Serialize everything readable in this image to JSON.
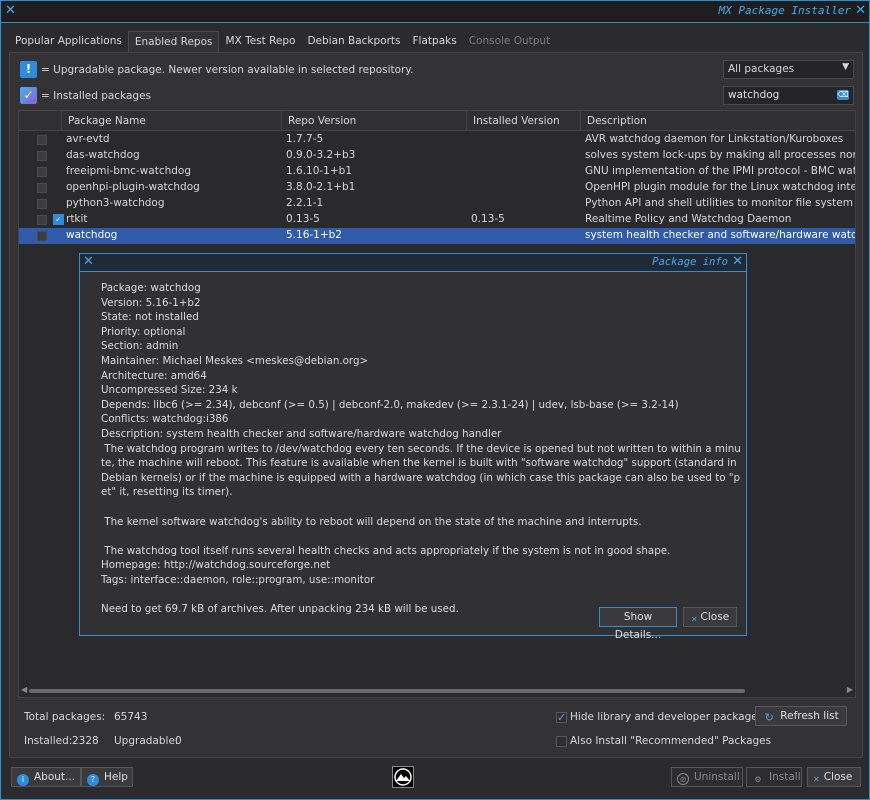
{
  "window": {
    "title": "MX Package Installer"
  },
  "tabs": [
    {
      "label": "Popular Applications",
      "active": false,
      "disabled": false
    },
    {
      "label": "Enabled Repos",
      "active": true,
      "disabled": false
    },
    {
      "label": "MX Test Repo",
      "active": false,
      "disabled": false
    },
    {
      "label": "Debian Backports",
      "active": false,
      "disabled": false
    },
    {
      "label": "Flatpaks",
      "active": false,
      "disabled": false
    },
    {
      "label": "Console Output",
      "active": false,
      "disabled": true
    }
  ],
  "legend": {
    "upgradable": "= Upgradable package. Newer version available in selected repository.",
    "installed": "= Installed packages"
  },
  "filter": {
    "selected": "All packages"
  },
  "search": {
    "value": "watchdog"
  },
  "table": {
    "columns": [
      "Package Name",
      "Repo Version",
      "Installed Version",
      "Description"
    ],
    "rows": [
      {
        "name": "avr-evtd",
        "repo": "1.7.7-5",
        "installed": "",
        "desc": "AVR watchdog daemon for Linkstation/Kuroboxes",
        "checked": false,
        "selected": false
      },
      {
        "name": "das-watchdog",
        "repo": "0.9.0-3.2+b3",
        "installed": "",
        "desc": "solves system lock-ups by making all processes non-realtime",
        "checked": false,
        "selected": false
      },
      {
        "name": "freeipmi-bmc-watchdog",
        "repo": "1.6.10-1+b1",
        "installed": "",
        "desc": "GNU implementation of the IPMI protocol - BMC watchdog",
        "checked": false,
        "selected": false
      },
      {
        "name": "openhpi-plugin-watchdog",
        "repo": "3.8.0-2.1+b1",
        "installed": "",
        "desc": "OpenHPI plugin module for the Linux watchdog interface",
        "checked": false,
        "selected": false
      },
      {
        "name": "python3-watchdog",
        "repo": "2.2.1-1",
        "installed": "",
        "desc": "Python API and shell utilities to monitor file system events",
        "checked": false,
        "selected": false
      },
      {
        "name": "rtkit",
        "repo": "0.13-5",
        "installed": "0.13-5",
        "desc": "Realtime Policy and Watchdog Daemon",
        "checked": true,
        "selected": false
      },
      {
        "name": "watchdog",
        "repo": "5.16-1+b2",
        "installed": "",
        "desc": "system health checker and software/hardware watchdog handler",
        "checked": false,
        "selected": true
      }
    ]
  },
  "dialog": {
    "title": "Package info",
    "lines": [
      "Package: watchdog",
      "Version: 5.16-1+b2",
      "State: not installed",
      "Priority: optional",
      "Section: admin",
      "Maintainer: Michael Meskes <meskes@debian.org>",
      "Architecture: amd64",
      "Uncompressed Size: 234 k",
      "Depends: libc6 (>= 2.34), debconf (>= 0.5) | debconf-2.0, makedev (>= 2.3.1-24) | udev, lsb-base (>= 3.2-14)",
      "Conflicts: watchdog:i386",
      "Description: system health checker and software/hardware watchdog handler"
    ],
    "paragraph1": " The watchdog program writes to /dev/watchdog every ten seconds. If the device is opened but not written to within a minute, the machine will reboot. This feature is available when the kernel is built with \"software watchdog\" support (standard in Debian kernels) or if the machine is equipped with a hardware watchdog (in which case this package can also be used to \"pet\" it, resetting its timer).",
    "paragraph2": " The kernel software watchdog's ability to reboot will depend on the state of the machine and interrupts.",
    "paragraph3": " The watchdog tool itself runs several health checks and acts appropriately if the system is not in good shape.",
    "homepage": "Homepage: http://watchdog.sourceforge.net",
    "tags": "Tags: interface::daemon, role::program, use::monitor",
    "download": "Need to get 69.7 kB of archives. After unpacking 234 kB will be used.",
    "show_details": "Show Details...",
    "close": "Close"
  },
  "stats": {
    "total_label": "Total packages:",
    "total_value": "65743",
    "installed_label": "Installed:",
    "installed_value": "2328",
    "upgradable_label": "Upgradable:",
    "upgradable_value": "0"
  },
  "options": {
    "hide_lib": "Hide library and developer packages",
    "hide_lib_checked": true,
    "recommended": "Also Install \"Recommended\" Packages",
    "recommended_checked": false,
    "refresh": "Refresh list"
  },
  "footer": {
    "about": "About...",
    "help": "Help",
    "uninstall": "Uninstall",
    "install": "Install",
    "close": "Close"
  }
}
